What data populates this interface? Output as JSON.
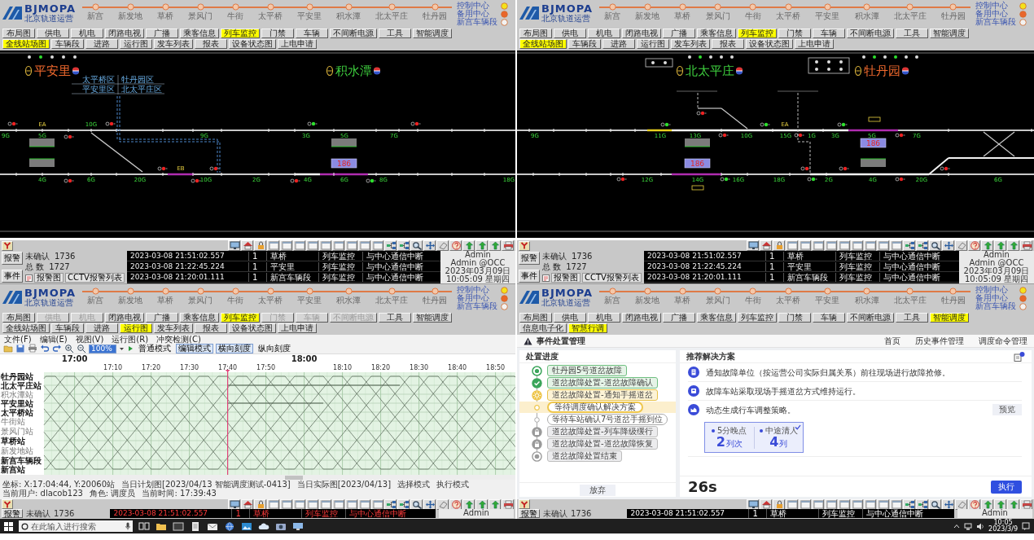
{
  "panels": [
    {
      "kind": "station_view",
      "header": {
        "logo": "BJMOPA",
        "logo_subtitle": "北京轨道运营",
        "route": [
          "新宫",
          "新发地",
          "草桥",
          "景风门",
          "牛街",
          "太平桥",
          "平安里",
          "积水潭",
          "北太平庄",
          "牡丹园"
        ],
        "legend": [
          {
            "label": "控制中心",
            "color": "#f4e21c"
          },
          {
            "label": "备用中心",
            "color": "#e9662b"
          },
          {
            "label": "新宫车辆段",
            "color": "#f2f2f2"
          }
        ]
      },
      "nav_rows": [
        [
          {
            "label": "布局图",
            "selected": false
          },
          {
            "label": "供电",
            "selected": false
          },
          {
            "label": "机电",
            "selected": false
          },
          {
            "label": "闭路电视",
            "selected": false
          },
          {
            "label": "广播",
            "selected": false
          },
          {
            "label": "乘客信息",
            "selected": false
          },
          {
            "label": "列车监控",
            "selected": true
          },
          {
            "label": "门禁",
            "selected": false
          },
          {
            "label": "车辆",
            "selected": false
          },
          {
            "label": "不间断电源",
            "selected": false
          },
          {
            "label": "工具",
            "selected": false
          },
          {
            "label": "智能调度",
            "selected": false
          }
        ],
        [
          {
            "label": "全线站场图",
            "selected": true
          },
          {
            "label": "车辆段",
            "selected": false
          },
          {
            "label": "进路",
            "selected": false
          },
          {
            "label": "运行图",
            "selected": false
          },
          {
            "label": "发车列表",
            "selected": false
          },
          {
            "label": "报表",
            "selected": false
          },
          {
            "label": "设备状态图",
            "selected": false
          },
          {
            "label": "上电申请",
            "selected": false
          }
        ]
      ],
      "diagram": {
        "stations": [
          {
            "name": "平安里",
            "color": "#f26a2e"
          },
          {
            "name": "积水潭",
            "color": "#3fd13f"
          }
        ],
        "route_tags": [
          "太平桥区",
          "牡丹园区",
          "平安里区",
          "北太平庄区"
        ],
        "track_labels": [
          {
            "text": "EA",
            "kind": "marker"
          },
          {
            "text": "10G",
            "kind": "section"
          },
          {
            "text": "9G",
            "kind": "section"
          },
          {
            "text": "5G",
            "kind": "section"
          },
          {
            "text": "9G",
            "kind": "section"
          },
          {
            "text": "3G",
            "kind": "section"
          },
          {
            "text": "5G",
            "kind": "section"
          },
          {
            "text": "7G",
            "kind": "section"
          },
          {
            "text": "EB",
            "kind": "marker"
          },
          {
            "text": "4G",
            "kind": "section"
          },
          {
            "text": "6G",
            "kind": "section"
          },
          {
            "text": "20G",
            "kind": "section"
          },
          {
            "text": "10G",
            "kind": "section"
          },
          {
            "text": "2G",
            "kind": "section"
          },
          {
            "text": "4G",
            "kind": "section"
          },
          {
            "text": "6G",
            "kind": "section"
          },
          {
            "text": "8G",
            "kind": "section"
          },
          {
            "text": "18G",
            "kind": "section"
          }
        ],
        "trains": [
          "186"
        ]
      }
    },
    {
      "kind": "station_view",
      "header": {
        "logo": "BJMOPA",
        "logo_subtitle": "北京轨道运营",
        "route": [
          "新宫",
          "新发地",
          "草桥",
          "景风门",
          "牛街",
          "太平桥",
          "平安里",
          "积水潭",
          "北太平庄",
          "牡丹园"
        ],
        "legend": [
          {
            "label": "控制中心",
            "color": "#f4e21c"
          },
          {
            "label": "备用中心",
            "color": "#e9662b"
          },
          {
            "label": "新宫车辆段",
            "color": "#f2f2f2"
          }
        ]
      },
      "nav_rows": [
        [
          {
            "label": "布局图",
            "selected": false
          },
          {
            "label": "供电",
            "selected": false
          },
          {
            "label": "机电",
            "selected": false
          },
          {
            "label": "闭路电视",
            "selected": false
          },
          {
            "label": "广播",
            "selected": false
          },
          {
            "label": "乘客信息",
            "selected": false
          },
          {
            "label": "列车监控",
            "selected": true
          },
          {
            "label": "门禁",
            "selected": false
          },
          {
            "label": "车辆",
            "selected": false
          },
          {
            "label": "不间断电源",
            "selected": false
          },
          {
            "label": "工具",
            "selected": false
          },
          {
            "label": "智能调度",
            "selected": false
          }
        ],
        [
          {
            "label": "全线站场图",
            "selected": true
          },
          {
            "label": "车辆段",
            "selected": false
          },
          {
            "label": "进路",
            "selected": false
          },
          {
            "label": "运行图",
            "selected": false
          },
          {
            "label": "发车列表",
            "selected": false
          },
          {
            "label": "报表",
            "selected": false
          },
          {
            "label": "设备状态图",
            "selected": false
          },
          {
            "label": "上电申请",
            "selected": false
          }
        ]
      ],
      "diagram": {
        "stations": [
          {
            "name": "北太平庄",
            "color": "#3fd13f"
          },
          {
            "name": "牡丹园",
            "color": "#f26a2e"
          }
        ],
        "track_labels": [
          {
            "text": "9G",
            "kind": "section"
          },
          {
            "text": "11G",
            "kind": "section"
          },
          {
            "text": "13G",
            "kind": "section"
          },
          {
            "text": "10G",
            "kind": "section"
          },
          {
            "text": "EA",
            "kind": "marker"
          },
          {
            "text": "15G",
            "kind": "section"
          },
          {
            "text": "1G",
            "kind": "section"
          },
          {
            "text": "3G",
            "kind": "section"
          },
          {
            "text": "5G",
            "kind": "section"
          },
          {
            "text": "7G",
            "kind": "section"
          },
          {
            "text": "12G",
            "kind": "section"
          },
          {
            "text": "14G",
            "kind": "section"
          },
          {
            "text": "16G",
            "kind": "section"
          },
          {
            "text": "18G",
            "kind": "section"
          },
          {
            "text": "2G",
            "kind": "section"
          },
          {
            "text": "4G",
            "kind": "section"
          },
          {
            "text": "20G",
            "kind": "section"
          },
          {
            "text": "6G",
            "kind": "section"
          }
        ],
        "trains": [
          "186",
          "186"
        ]
      }
    },
    {
      "kind": "train_graph",
      "alarm_bar": {
        "buttons": [
          "报警",
          "事件"
        ],
        "counts": [
          {
            "label": "未确认",
            "value": "1736"
          },
          {
            "label": "总 数",
            "value": "1727"
          }
        ],
        "small_buttons": [
          "报警图",
          "CCTV报警列表"
        ],
        "alarms": [
          {
            "time": "2023-03-08 21:51:02.557",
            "count": "1",
            "station": "草桥",
            "system": "列车监控",
            "message": "与中心通信中断"
          },
          {
            "time": "2023-03-08 21:22:45.224",
            "count": "1",
            "station": "平安里",
            "system": "列车监控",
            "message": "与中心通信中断"
          },
          {
            "time": "2023-03-08 21:20:01.111",
            "count": "1",
            "station": "新宫车辆段",
            "system": "列车监控",
            "message": "与中心通信中断"
          }
        ],
        "user": [
          "Admin",
          "Admin @OCC",
          "2023年03月09日",
          "10:05:09 星期四"
        ]
      },
      "header": {
        "logo": "BJMOPA",
        "logo_subtitle": "北京轨道运营",
        "route": [
          "新宫",
          "新发地",
          "草桥",
          "景风门",
          "牛街",
          "太平桥",
          "平安里",
          "积水潭",
          "北太平庄",
          "牡丹园"
        ],
        "legend": [
          {
            "label": "控制中心",
            "color": "#f4e21c"
          },
          {
            "label": "备用中心",
            "color": "#e9662b"
          },
          {
            "label": "新宫车辆段",
            "color": "#f2f2f2"
          }
        ]
      },
      "nav_rows": [
        [
          {
            "label": "布局图",
            "selected": false,
            "disabled": false
          },
          {
            "label": "供电",
            "selected": false,
            "disabled": true
          },
          {
            "label": "机电",
            "selected": false,
            "disabled": true
          },
          {
            "label": "闭路电视",
            "selected": false,
            "disabled": false
          },
          {
            "label": "广播",
            "selected": false,
            "disabled": false
          },
          {
            "label": "乘客信息",
            "selected": false,
            "disabled": false
          },
          {
            "label": "列车监控",
            "selected": true,
            "disabled": false
          },
          {
            "label": "门禁",
            "selected": false,
            "disabled": true
          },
          {
            "label": "车辆",
            "selected": false,
            "disabled": true
          },
          {
            "label": "不间断电源",
            "selected": false,
            "disabled": true
          },
          {
            "label": "工具",
            "selected": false,
            "disabled": false
          },
          {
            "label": "智能调度",
            "selected": false,
            "disabled": false
          }
        ],
        [
          {
            "label": "全线站场图",
            "selected": false
          },
          {
            "label": "车辆段",
            "selected": false
          },
          {
            "label": "进路",
            "selected": false
          },
          {
            "label": "运行图",
            "selected": true
          },
          {
            "label": "发车列表",
            "selected": false
          },
          {
            "label": "报表",
            "selected": false
          },
          {
            "label": "设备状态图",
            "selected": false
          },
          {
            "label": "上电申请",
            "selected": false
          }
        ]
      ],
      "graph": {
        "menu": [
          "文件(F)",
          "编辑(E)",
          "视图(V)",
          "运行图(R)",
          "冲突检测(C)"
        ],
        "toolbar": {
          "zoom": "100%",
          "buttons": [
            {
              "label": "普通模式",
              "selected": false
            },
            {
              "label": "编辑模式",
              "selected": true
            },
            {
              "label": "横向刻度",
              "selected": true
            },
            {
              "label": "纵向刻度",
              "selected": false
            }
          ]
        },
        "time_axis": {
          "hour_labels": [
            "17:00",
            "18:00"
          ],
          "tick_labels": [
            "17:10",
            "17:20",
            "17:30",
            "17:40",
            "17:50",
            "18:10",
            "18:20",
            "18:30",
            "18:40",
            "18:50"
          ]
        },
        "stations": [
          {
            "name": "牡丹园站",
            "highlighted": true
          },
          {
            "name": "北太平庄站",
            "highlighted": true
          },
          {
            "name": "积水潭站",
            "highlighted": false
          },
          {
            "name": "平安里站",
            "highlighted": true
          },
          {
            "name": "太平桥站",
            "highlighted": true
          },
          {
            "name": "牛街站",
            "highlighted": false
          },
          {
            "name": "景风门站",
            "highlighted": false
          },
          {
            "name": "草桥站",
            "highlighted": true
          },
          {
            "name": "新发地站",
            "highlighted": false
          },
          {
            "name": "新宫车辆段",
            "highlighted": true
          },
          {
            "name": "新宫站",
            "highlighted": true
          }
        ],
        "status_bar": [
          "坐标: X:17:04:44, Y:20060站",
          "当日计划图[2023/04/13 智能调度测试-0413]",
          "当日实际图[2023/04/13]",
          "选择模式",
          "执行模式",
          "当前用户: dlacob123",
          "角色: 调度员",
          "当前时间: 17:39:43"
        ]
      }
    },
    {
      "kind": "event_management",
      "alarm_bar": {
        "buttons": [
          "报警",
          "事件"
        ],
        "counts": [
          {
            "label": "未确认",
            "value": "1736"
          },
          {
            "label": "总 数",
            "value": "1727"
          }
        ],
        "small_buttons": [
          "报警图",
          "CCTV报警列表"
        ],
        "alarms": [
          {
            "time": "2023-03-08 21:51:02.557",
            "count": "1",
            "station": "草桥",
            "system": "列车监控",
            "message": "与中心通信中断"
          },
          {
            "time": "2023-03-08 21:22:45.224",
            "count": "1",
            "station": "平安里",
            "system": "列车监控",
            "message": "与中心通信中断"
          },
          {
            "time": "2023-03-08 21:20:01.111",
            "count": "1",
            "station": "新宫车辆段",
            "system": "列车监控",
            "message": "与中心通信中断"
          }
        ],
        "user": [
          "Admin",
          "Admin @OCC",
          "2023年03月09日",
          "10:05:09 星期四"
        ]
      },
      "header": {
        "logo": "BJMOPA",
        "logo_subtitle": "北京轨道运营",
        "route": [
          "新宫",
          "新发地",
          "草桥",
          "景风门",
          "牛街",
          "太平桥",
          "平安里",
          "积水潭",
          "北太平庄",
          "牡丹园"
        ],
        "legend": [
          {
            "label": "控制中心",
            "color": "#f4e21c"
          },
          {
            "label": "备用中心",
            "color": "#e9662b"
          },
          {
            "label": "新宫车辆段",
            "color": "#f2f2f2"
          }
        ]
      },
      "nav_rows": [
        [
          {
            "label": "布局图",
            "selected": false
          },
          {
            "label": "供电",
            "selected": false
          },
          {
            "label": "机电",
            "selected": false
          },
          {
            "label": "闭路电视",
            "selected": false
          },
          {
            "label": "广播",
            "selected": false
          },
          {
            "label": "乘客信息",
            "selected": false
          },
          {
            "label": "列车监控",
            "selected": false
          },
          {
            "label": "门禁",
            "selected": false
          },
          {
            "label": "车辆",
            "selected": false
          },
          {
            "label": "不间断电源",
            "selected": false
          },
          {
            "label": "工具",
            "selected": false
          },
          {
            "label": "智能调度",
            "selected": true
          }
        ],
        [
          {
            "label": "信息电子化",
            "selected": false
          },
          {
            "label": "智慧行调",
            "selected": true
          }
        ]
      ],
      "event_page": {
        "title": "事件处置管理",
        "links": [
          "首页",
          "历史事件管理",
          "调度命令管理"
        ],
        "progress": {
          "title": "处置进度",
          "steps": [
            {
              "text": "牡丹园5号道岔故障",
              "kind": "start"
            },
            {
              "text": "道岔故障处置-道岔故障确认",
              "kind": "done"
            },
            {
              "text": "道岔故障处置-通知手摇道岔",
              "kind": "in_progress"
            },
            {
              "text": "等待调度确认解决方案",
              "kind": "current"
            },
            {
              "text": "等待车站确认7号道岔手摇到位",
              "kind": "waiting"
            },
            {
              "text": "道岔故障处置-列车降级缓行",
              "kind": "locked"
            },
            {
              "text": "道岔故障处置-道岔故障恢复",
              "kind": "locked"
            },
            {
              "text": "道岔故障处置结束",
              "kind": "end"
            }
          ],
          "abandon_button": "放弃"
        },
        "solutions": {
          "title": "推荐解决方案",
          "items": [
            {
              "text": "通知故障单位（按运营公司实际归属关系）前往现场进行故障抢修。",
              "kind": "notice"
            },
            {
              "text": "故障车站采取现场手摇道岔方式维持运行。",
              "kind": "station"
            },
            {
              "text": "动态生成行车调整策略。",
              "kind": "strategy",
              "action": "预览"
            }
          ],
          "strategy": {
            "selected": true,
            "metrics": [
              {
                "label": "5分晚点",
                "value": "2",
                "unit": "列次"
              },
              {
                "label": "中途清人",
                "value": "4",
                "unit": "列"
              }
            ]
          },
          "countdown": "26s",
          "execute_button": "执行"
        }
      }
    }
  ],
  "bottom_strips": [
    {
      "button": "报警",
      "count_label": "未确认",
      "count_value": "1736",
      "alarm": {
        "time": "2023-03-08 21:51:02.557",
        "count": "1",
        "station": "草桥",
        "system": "列车监控",
        "message": "与中心通信中断",
        "highlighted": true
      },
      "user": "Admin"
    },
    {
      "button": "报警",
      "count_label": "未确认",
      "count_value": "1736",
      "alarm": {
        "time": "2023-03-08 21:51:02.557",
        "count": "1",
        "station": "草桥",
        "system": "列车监控",
        "message": "与中心通信中断",
        "highlighted": false
      },
      "user": "Admin"
    }
  ],
  "taskbar": {
    "search_placeholder": "在此输入进行搜索",
    "clock": [
      "10:05",
      "2023/3/9"
    ]
  }
}
